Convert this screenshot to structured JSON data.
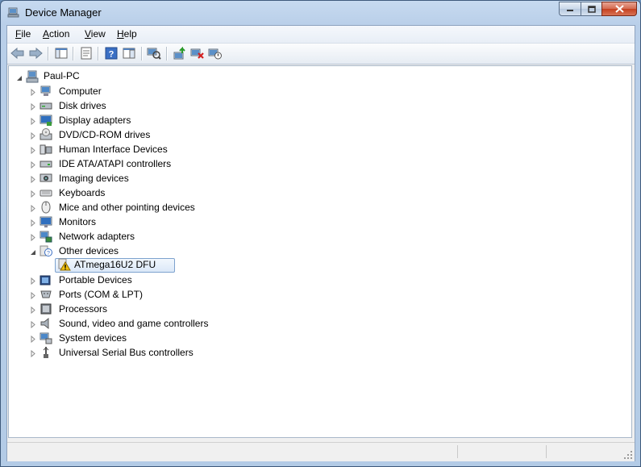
{
  "window": {
    "title": "Device Manager"
  },
  "menu": [
    {
      "label": "File",
      "mnemonic": "F",
      "rest": "ile"
    },
    {
      "label": "Action",
      "mnemonic": "A",
      "rest": "ction"
    },
    {
      "label": "View",
      "mnemonic": "V",
      "rest": "iew"
    },
    {
      "label": "Help",
      "mnemonic": "H",
      "rest": "elp"
    }
  ],
  "toolbar": [
    "back-icon",
    "forward-icon",
    "show-hide-tree-icon",
    "properties-icon",
    "help-icon",
    "action-pane-icon",
    "scan-hardware-icon",
    "update-driver-icon",
    "uninstall-icon",
    "disable-icon"
  ],
  "tree": {
    "root": "Paul-PC",
    "categories": [
      "Computer",
      "Disk drives",
      "Display adapters",
      "DVD/CD-ROM drives",
      "Human Interface Devices",
      "IDE ATA/ATAPI controllers",
      "Imaging devices",
      "Keyboards",
      "Mice and other pointing devices",
      "Monitors",
      "Network adapters",
      "Other devices",
      "Portable Devices",
      "Ports (COM & LPT)",
      "Processors",
      "Sound, video and game controllers",
      "System devices",
      "Universal Serial Bus controllers"
    ],
    "other_devices_child": "ATmega16U2 DFU"
  },
  "colors": {
    "selection_border": "#7da2ce",
    "warning": "#f2c10f"
  }
}
